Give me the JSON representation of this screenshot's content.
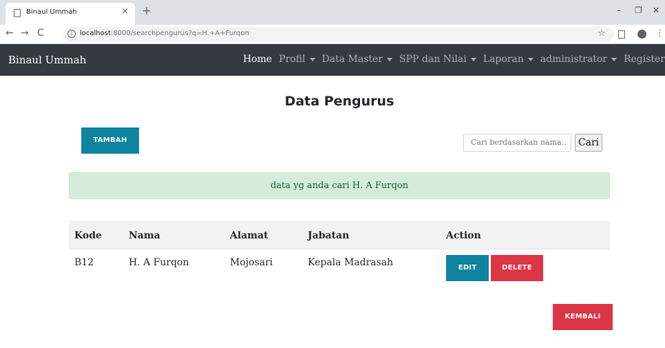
{
  "browser": {
    "tab_title": "Binaul Ummah",
    "tab_close": "×",
    "new_tab": "+",
    "url_host": "localhost",
    "url_rest": ":8000/searchpengurus?q=H.+A+Furqon",
    "info_glyph": "i",
    "back_glyph": "←",
    "forward_glyph": "→",
    "reload_glyph": "C",
    "star_glyph": "☆",
    "minimize_glyph": "–",
    "restore_glyph": "❐",
    "close_glyph": "✕",
    "menu_glyph": "⋮"
  },
  "navbar": {
    "brand": "Binaul Ummah",
    "items": [
      {
        "label": "Home",
        "dropdown": false
      },
      {
        "label": "Profil",
        "dropdown": true
      },
      {
        "label": "Data Master",
        "dropdown": true
      },
      {
        "label": "SPP dan Nilai",
        "dropdown": true
      },
      {
        "label": "Laporan",
        "dropdown": true
      },
      {
        "label": "administrator",
        "dropdown": true
      },
      {
        "label": "Register",
        "dropdown": false
      }
    ]
  },
  "page": {
    "title": "Data Pengurus",
    "tambah_label": "TAMBAH",
    "search_placeholder": "Cari berdasarkan nama..",
    "search_button": "Cari",
    "alert_text": "data yg anda cari H. A Furqon",
    "kembali_label": "KEMBALI"
  },
  "table": {
    "headers": [
      "Kode",
      "Nama",
      "Alamat",
      "Jabatan",
      "Action"
    ],
    "rows": [
      {
        "kode": "B12",
        "nama": "H. A Furqon",
        "alamat": "Mojosari",
        "jabatan": "Kepala Madrasah",
        "edit_label": "EDIT",
        "delete_label": "DELETE"
      }
    ]
  },
  "colors": {
    "navbar_bg": "#343a40",
    "primary_button": "#0f84a0",
    "danger_button": "#dc3545",
    "alert_bg": "#d4edda",
    "alert_text": "#155724"
  }
}
